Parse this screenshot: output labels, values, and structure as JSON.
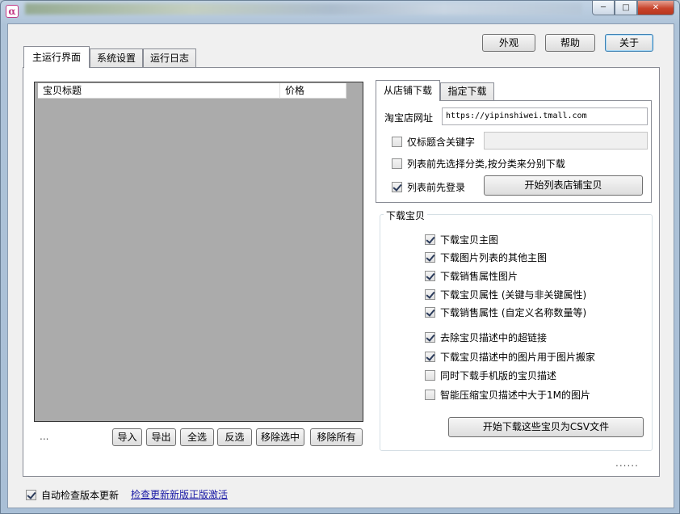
{
  "window": {
    "icon_glyph": "α",
    "controls": {
      "minimize": "─",
      "maximize": "□",
      "close": "✕"
    }
  },
  "header_buttons": {
    "appearance": "外观",
    "help": "帮助",
    "about": "关于"
  },
  "tabs": [
    {
      "label": "主运行界面",
      "active": true
    },
    {
      "label": "系统设置",
      "active": false
    },
    {
      "label": "运行日志",
      "active": false
    }
  ],
  "item_list": {
    "columns": [
      "宝贝标题",
      "价格"
    ],
    "rows": [],
    "status_text": "..."
  },
  "list_buttons": {
    "import": "导入",
    "export": "导出",
    "select_all": "全选",
    "invert": "反选",
    "remove_selected": "移除选中",
    "remove_all": "移除所有"
  },
  "source_tabs": [
    {
      "label": "从店铺下载",
      "active": true
    },
    {
      "label": "指定下载",
      "active": false
    }
  ],
  "store_download": {
    "url_label": "淘宝店网址",
    "url_value": "https://yipinshiwei.tmall.com",
    "keyword_checkbox": {
      "label": "仅标题含关键字",
      "checked": false
    },
    "keyword_value": "",
    "category_checkbox": {
      "label": "列表前先选择分类,按分类来分别下载",
      "checked": false
    },
    "login_checkbox": {
      "label": "列表前先登录",
      "checked": true
    },
    "start_button": "开始列表店铺宝贝"
  },
  "download_group": {
    "title": "下载宝贝",
    "options": [
      {
        "label": "下载宝贝主图",
        "checked": true
      },
      {
        "label": "下载图片列表的其他主图",
        "checked": true
      },
      {
        "label": "下载销售属性图片",
        "checked": true
      },
      {
        "label": "下载宝贝属性 (关键与非关键属性)",
        "checked": true
      },
      {
        "label": "下载销售属性 (自定义名称数量等)",
        "checked": true
      },
      {
        "label": "去除宝贝描述中的超链接",
        "checked": true
      },
      {
        "label": "下载宝贝描述中的图片用于图片搬家",
        "checked": true
      },
      {
        "label": "同时下载手机版的宝贝描述",
        "checked": false
      },
      {
        "label": "智能压缩宝贝描述中大于1M的图片",
        "checked": false
      }
    ],
    "start_button": "开始下载这些宝贝为CSV文件"
  },
  "progress_dots": "......",
  "footer": {
    "auto_update_checkbox": {
      "label": "自动检查版本更新",
      "checked": true
    },
    "check_update_link": "检查更新新版",
    "activate_link": "正版激活"
  }
}
